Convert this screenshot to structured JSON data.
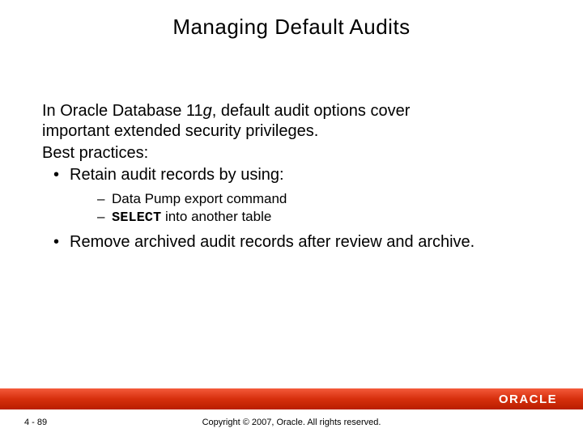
{
  "title": "Managing Default Audits",
  "intro": {
    "prefix": "In Oracle Database 11",
    "ital": "g",
    "suffix": ", default audit options cover",
    "line2": "important extended security privileges."
  },
  "best_practices_label": "Best practices:",
  "bullets": {
    "b1_prefix": "Retain audit records by using:",
    "sub1": "Data Pump export command",
    "sub2_mono": "SELECT",
    "sub2_rest": " into another table",
    "b2": "Remove archived audit records after review and archive."
  },
  "footer": {
    "page": "4 - 89",
    "copyright": "Copyright © 2007, Oracle. All rights reserved.",
    "logo_text": "ORACLE"
  }
}
